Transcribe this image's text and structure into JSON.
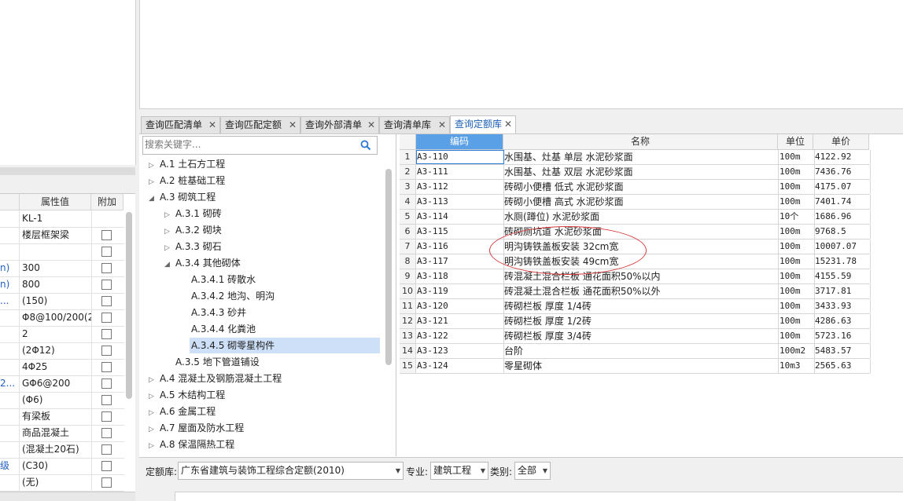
{
  "property_panel": {
    "columns": [
      "属性值",
      "附加"
    ],
    "rows": [
      {
        "name": "",
        "value": "KL-1",
        "checkbox": false
      },
      {
        "name": "",
        "value": "楼层框架梁",
        "checkbox": true
      },
      {
        "name": "",
        "value": "",
        "checkbox": true
      },
      {
        "name": "n)",
        "value": "300",
        "checkbox": true
      },
      {
        "name": "n)",
        "value": "800",
        "checkbox": true
      },
      {
        "name": "...",
        "value": "(150)",
        "checkbox": true
      },
      {
        "name": "",
        "value": "Φ8@100/200(2",
        "checkbox": true
      },
      {
        "name": "",
        "value": "2",
        "checkbox": true
      },
      {
        "name": "",
        "value": "(2Φ12)",
        "checkbox": true
      },
      {
        "name": "",
        "value": "4Φ25",
        "checkbox": true
      },
      {
        "name": "2...",
        "value": "GΦ6@200",
        "checkbox": true
      },
      {
        "name": "",
        "value": "(Φ6)",
        "checkbox": true
      },
      {
        "name": "",
        "value": "有梁板",
        "checkbox": true
      },
      {
        "name": "",
        "value": "商品混凝土",
        "checkbox": true
      },
      {
        "name": "",
        "value": "(混凝土20石)",
        "checkbox": true
      },
      {
        "name": "级",
        "value": "(C30)",
        "checkbox": true
      },
      {
        "name": "",
        "value": "(无)",
        "checkbox": true
      }
    ]
  },
  "tabs": [
    {
      "label": "查询匹配清单",
      "active": false
    },
    {
      "label": "查询匹配定额",
      "active": false
    },
    {
      "label": "查询外部清单",
      "active": false
    },
    {
      "label": "查询清单库",
      "active": false
    },
    {
      "label": "查询定额库",
      "active": true
    }
  ],
  "close_glyph": "✕",
  "search": {
    "placeholder": "搜索关键字..."
  },
  "tree": [
    {
      "label": "A.1 土石方工程",
      "level": 0,
      "state": "collapsed"
    },
    {
      "label": "A.2 桩基础工程",
      "level": 0,
      "state": "collapsed"
    },
    {
      "label": "A.3 砌筑工程",
      "level": 0,
      "state": "expanded"
    },
    {
      "label": "A.3.1 砌砖",
      "level": 1,
      "state": "collapsed"
    },
    {
      "label": "A.3.2 砌块",
      "level": 1,
      "state": "collapsed"
    },
    {
      "label": "A.3.3 砌石",
      "level": 1,
      "state": "collapsed"
    },
    {
      "label": "A.3.4 其他砌体",
      "level": 1,
      "state": "expanded"
    },
    {
      "label": "A.3.4.1 砖散水",
      "level": 2,
      "state": "leaf"
    },
    {
      "label": "A.3.4.2 地沟、明沟",
      "level": 2,
      "state": "leaf"
    },
    {
      "label": "A.3.4.3 砂井",
      "level": 2,
      "state": "leaf"
    },
    {
      "label": "A.3.4.4 化粪池",
      "level": 2,
      "state": "leaf"
    },
    {
      "label": "A.3.4.5 砌零星构件",
      "level": 2,
      "state": "leaf",
      "selected": true
    },
    {
      "label": "A.3.5 地下管道铺设",
      "level": 1,
      "state": "leaf"
    },
    {
      "label": "A.4 混凝土及钢筋混凝土工程",
      "level": 0,
      "state": "collapsed"
    },
    {
      "label": "A.5 木结构工程",
      "level": 0,
      "state": "collapsed"
    },
    {
      "label": "A.6 金属工程",
      "level": 0,
      "state": "collapsed"
    },
    {
      "label": "A.7 屋面及防水工程",
      "level": 0,
      "state": "collapsed"
    },
    {
      "label": "A.8 保温隔热工程",
      "level": 0,
      "state": "collapsed"
    }
  ],
  "grid": {
    "columns": {
      "code": "编码",
      "name": "名称",
      "unit": "单位",
      "price": "单价"
    },
    "rows": [
      {
        "num": "1",
        "code": "A3-110",
        "name": "水围基、灶基 单层 水泥砂浆面",
        "unit": "100m",
        "price": "4122.92"
      },
      {
        "num": "2",
        "code": "A3-111",
        "name": "水围基、灶基 双层 水泥砂浆面",
        "unit": "100m",
        "price": "7436.76"
      },
      {
        "num": "3",
        "code": "A3-112",
        "name": "砖砌小便槽 低式 水泥砂浆面",
        "unit": "100m",
        "price": "4175.07"
      },
      {
        "num": "4",
        "code": "A3-113",
        "name": "砖砌小便槽 高式 水泥砂浆面",
        "unit": "100m",
        "price": "7401.74"
      },
      {
        "num": "5",
        "code": "A3-114",
        "name": "水厕(蹲位) 水泥砂浆面",
        "unit": "10个",
        "price": "1686.96"
      },
      {
        "num": "6",
        "code": "A3-115",
        "name": "砖砌厕坑道 水泥砂浆面",
        "unit": "100m",
        "price": "9768.5"
      },
      {
        "num": "7",
        "code": "A3-116",
        "name": "明沟铸铁盖板安装 32cm宽",
        "unit": "100m",
        "price": "10007.07"
      },
      {
        "num": "8",
        "code": "A3-117",
        "name": "明沟铸铁盖板安装 49cm宽",
        "unit": "100m",
        "price": "15231.78"
      },
      {
        "num": "9",
        "code": "A3-118",
        "name": "砖混凝土混合栏板 通花面积50%以内",
        "unit": "100m",
        "price": "4155.59"
      },
      {
        "num": "10",
        "code": "A3-119",
        "name": "砖混凝土混合栏板 通花面积50%以外",
        "unit": "100m",
        "price": "3717.81"
      },
      {
        "num": "11",
        "code": "A3-120",
        "name": "砖砌栏板 厚度 1/4砖",
        "unit": "100m",
        "price": "3433.93"
      },
      {
        "num": "12",
        "code": "A3-121",
        "name": "砖砌栏板 厚度 1/2砖",
        "unit": "100m",
        "price": "4286.63"
      },
      {
        "num": "13",
        "code": "A3-122",
        "name": "砖砌栏板 厚度 3/4砖",
        "unit": "100m",
        "price": "5723.16"
      },
      {
        "num": "14",
        "code": "A3-123",
        "name": "台阶",
        "unit": "100m2",
        "price": "5483.57"
      },
      {
        "num": "15",
        "code": "A3-124",
        "name": "零星砌体",
        "unit": "10m3",
        "price": "2565.63"
      }
    ]
  },
  "bottom": {
    "quota_label": "定额库:",
    "quota_value": "广东省建筑与装饰工程综合定额(2010)",
    "major_label": "专业:",
    "major_value": "建筑工程",
    "category_label": "类别:",
    "category_value": "全部"
  },
  "colors": {
    "accent": "#5aa0e6",
    "annotation": "#d83a3a",
    "selected": "#cde0f7"
  }
}
